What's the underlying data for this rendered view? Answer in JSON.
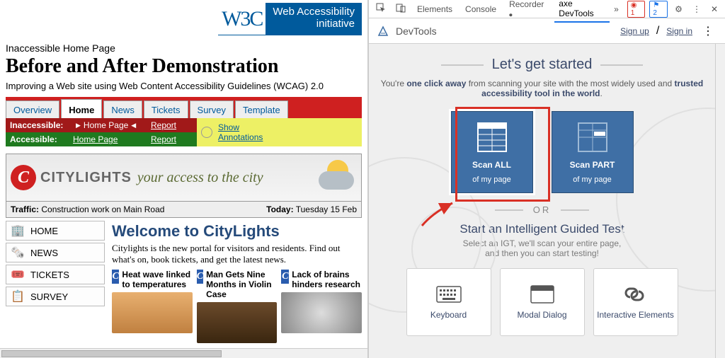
{
  "left": {
    "w3c": "W3C",
    "wai_line1": "Web Accessibility",
    "wai_line2": "initiative",
    "sub": "Inaccessible Home Page",
    "title": "Before and After Demonstration",
    "desc": "Improving a Web site using Web Content Accessibility Guidelines (WCAG) 2.0",
    "tabs": [
      "Overview",
      "Home",
      "News",
      "Tickets",
      "Survey",
      "Template"
    ],
    "inaccessible_label": "Inaccessible:",
    "accessible_label": "Accessible:",
    "home_page_link": "Home Page",
    "report_link": "Report",
    "annotations_line1": "Show",
    "annotations_line2": "Annotations",
    "brand": "CITYLIGHTS",
    "tagline": "your access to the city",
    "traffic_label": "Traffic:",
    "traffic_value": "Construction work on Main Road",
    "today_label": "Today:",
    "today_value": "Tuesday 15 Feb",
    "side": [
      {
        "icon": "🏢",
        "label": "HOME"
      },
      {
        "icon": "🗞️",
        "label": "NEWS"
      },
      {
        "icon": "🎟️",
        "label": "TICKETS"
      },
      {
        "icon": "📋",
        "label": "SURVEY"
      }
    ],
    "welcome": "Welcome to CityLights",
    "intro": "Citylights is the new portal for visitors and residents. Find out what's on, book tickets, and get the latest news.",
    "cards": [
      "Heat wave linked to temperatures",
      "Man Gets Nine Months in Violin Case",
      "Lack of brains hinders research"
    ]
  },
  "right": {
    "top_tabs": [
      "Elements",
      "Console",
      "Recorder"
    ],
    "axe_tab": "axe DevTools",
    "err_count": "1",
    "info_count": "2",
    "brand": "DevTools",
    "signup": "Sign up",
    "signin": "Sign in",
    "started": "Let's get started",
    "tag_pre": "You're ",
    "tag_bold1": "one click away",
    "tag_mid": " from scanning your site with the most widely used and ",
    "tag_bold2": "trusted accessibility tool in the world",
    "scan_all_l1": "Scan ALL",
    "scan_all_l2": "of my page",
    "scan_part_l1": "Scan PART",
    "scan_part_l2": "of my page",
    "or": "OR",
    "igt_h": "Start an Intelligent Guided Test",
    "igt_d1": "Select an IGT, we'll scan your entire page,",
    "igt_d2": "and then you can start testing!",
    "tiles": [
      "Keyboard",
      "Modal Dialog",
      "Interactive Elements"
    ]
  }
}
